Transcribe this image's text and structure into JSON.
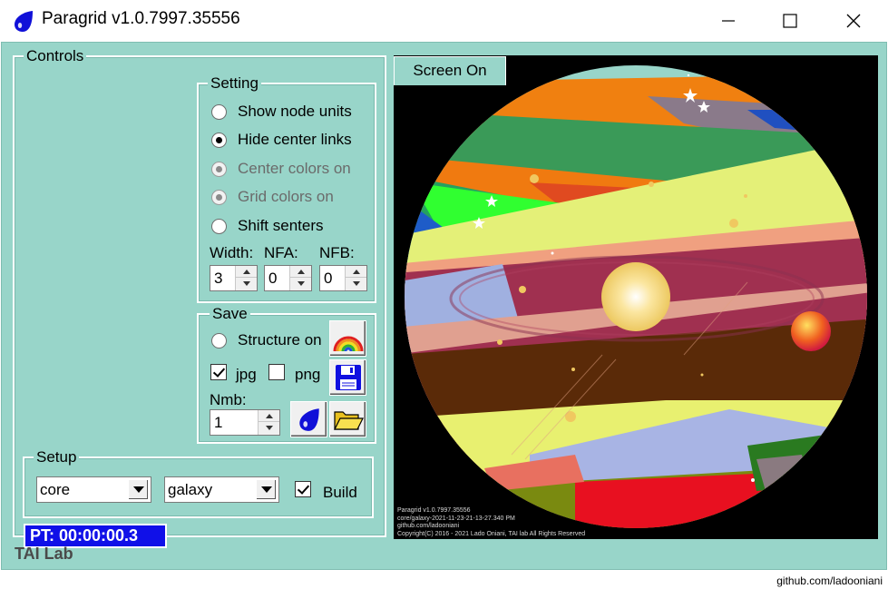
{
  "window": {
    "title": "Paragrid v1.0.7997.35556",
    "app_icon": "blue-drop-icon",
    "controls": [
      "minimize-icon",
      "maximize-icon",
      "close-icon"
    ]
  },
  "controls_group": {
    "label": "Controls"
  },
  "setting": {
    "label": "Setting",
    "options": [
      {
        "label": "Show node units",
        "checked": false,
        "enabled": true
      },
      {
        "label": "Hide center links",
        "checked": true,
        "enabled": true
      },
      {
        "label": "Center colors on",
        "checked": true,
        "enabled": false
      },
      {
        "label": "Grid colors on",
        "checked": true,
        "enabled": false
      },
      {
        "label": "Shift senters",
        "checked": false,
        "enabled": true
      }
    ],
    "fields": [
      {
        "label": "Width:",
        "value": "3"
      },
      {
        "label": "NFA:",
        "value": "0"
      },
      {
        "label": "NFB:",
        "value": "0"
      }
    ]
  },
  "save": {
    "label": "Save",
    "structure_label": "Structure on",
    "jpg_label": "jpg",
    "jpg_checked": true,
    "png_label": "png",
    "png_checked": false,
    "nmb_label": "Nmb:",
    "nmb_value": "1",
    "icons": [
      "rainbow-icon",
      "floppy-disk-icon",
      "blue-drop-icon",
      "folder-open-icon"
    ]
  },
  "setup": {
    "label": "Setup",
    "combo1": "core",
    "combo2": "galaxy",
    "build_label": "Build",
    "build_checked": true
  },
  "status": {
    "pt": "PT: 00:00:00.3",
    "pt_color": "#1010e8"
  },
  "footer_label": "TAI Lab",
  "screen": {
    "tab_label": "Screen On",
    "credits": [
      "Paragrid v1.0.7997.35556",
      "core/galaxy-2021-11-23-21-13-27.340 PM",
      "github.com/ladooniani",
      "Copyright(C) 2016 - 2021 Lado Oniani, TAI lab All Rights Reserved"
    ]
  },
  "watermark": "github.com/ladooniani",
  "colors": {
    "panel": "#98d5c9",
    "canvas": "#000000",
    "accent": "#1010e8"
  }
}
